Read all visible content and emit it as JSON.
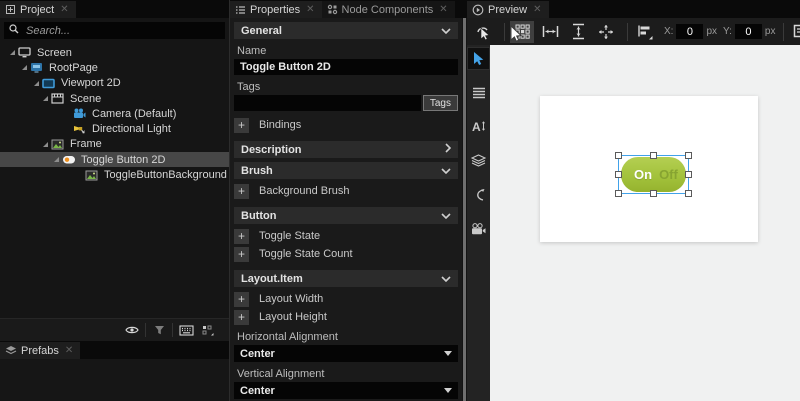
{
  "project": {
    "tab_label": "Project",
    "search_placeholder": "Search...",
    "tree": [
      {
        "label": "Screen"
      },
      {
        "label": "RootPage"
      },
      {
        "label": "Viewport 2D"
      },
      {
        "label": "Scene"
      },
      {
        "label": "Camera (Default)"
      },
      {
        "label": "Directional Light"
      },
      {
        "label": "Frame"
      },
      {
        "label": "Toggle Button 2D"
      },
      {
        "label": "ToggleButtonBackground"
      }
    ]
  },
  "prefabs": {
    "tab_label": "Prefabs"
  },
  "properties": {
    "tab_label": "Properties",
    "node_components_tab_label": "Node Components",
    "general": {
      "title": "General",
      "name_label": "Name",
      "name_value": "Toggle Button 2D",
      "tags_label": "Tags",
      "tags_button_label": "Tags",
      "tags_value": "",
      "bindings_label": "Bindings"
    },
    "description": {
      "title": "Description"
    },
    "brush": {
      "title": "Brush",
      "background_brush_label": "Background Brush"
    },
    "button": {
      "title": "Button",
      "toggle_state_label": "Toggle State",
      "toggle_state_count_label": "Toggle State Count"
    },
    "layout": {
      "title": "Layout.Item",
      "layout_width_label": "Layout Width",
      "layout_height_label": "Layout Height",
      "horizontal_alignment_label": "Horizontal Alignment",
      "horizontal_alignment_value": "Center",
      "vertical_alignment_label": "Vertical Alignment",
      "vertical_alignment_value": "Center"
    }
  },
  "preview": {
    "tab_label": "Preview",
    "toolbar": {
      "x_label": "X:",
      "x_value": "0",
      "x_unit": "px",
      "y_label": "Y:",
      "y_value": "0",
      "y_unit": "px"
    },
    "canvas": {
      "toggle_on_label": "On",
      "toggle_off_label": "Off"
    }
  },
  "colors": {
    "accent_blue": "#2674bf",
    "selection_blue": "#41a2ea",
    "toggle_green": "#a3c23c",
    "toggle_off_text": "#87a431",
    "panel_dark": "#1a1a1a"
  }
}
